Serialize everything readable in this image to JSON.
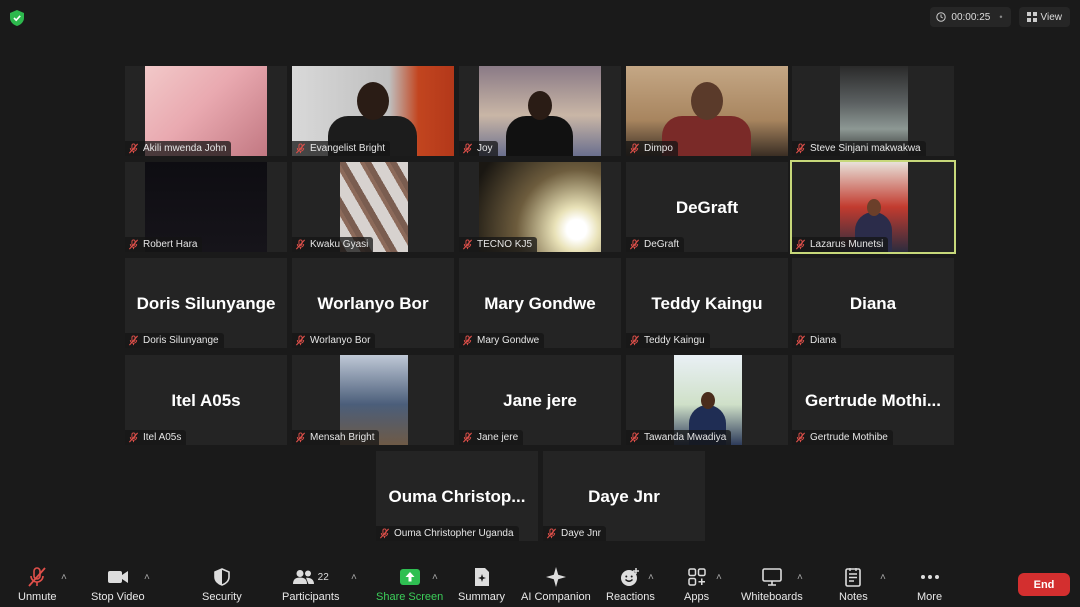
{
  "header": {
    "timer": "00:00:25",
    "view_label": "View"
  },
  "participants": [
    {
      "name": "Akili mwenda John",
      "display": "",
      "video": "akili-video"
    },
    {
      "name": "Evangelist Bright",
      "display": "",
      "video": "bright-video"
    },
    {
      "name": "Joy",
      "display": "",
      "video": "joy-video"
    },
    {
      "name": "Dimpo",
      "display": "",
      "video": "dimpo-video"
    },
    {
      "name": "Steve Sinjani makwakwa",
      "display": "",
      "video": "steve-video"
    },
    {
      "name": "Robert Hara",
      "display": "",
      "video": "robert-video"
    },
    {
      "name": "Kwaku Gyasi",
      "display": "",
      "video": "kwaku-video"
    },
    {
      "name": "TECNO KJ5",
      "display": "",
      "video": "tecno-video"
    },
    {
      "name": "DeGraft",
      "display": "DeGraft",
      "video": ""
    },
    {
      "name": "Lazarus Munetsi",
      "display": "",
      "video": "lazarus-video"
    },
    {
      "name": "Doris Silunyange",
      "display": "Doris Silunyange",
      "video": ""
    },
    {
      "name": "Worlanyo Bor",
      "display": "Worlanyo Bor",
      "video": ""
    },
    {
      "name": "Mary Gondwe",
      "display": "Mary Gondwe",
      "video": ""
    },
    {
      "name": "Teddy Kaingu",
      "display": "Teddy Kaingu",
      "video": ""
    },
    {
      "name": "Diana",
      "display": "Diana",
      "video": ""
    },
    {
      "name": "Itel A05s",
      "display": "Itel A05s",
      "video": ""
    },
    {
      "name": "Mensah Bright",
      "display": "",
      "video": "mensah-video"
    },
    {
      "name": "Jane jere",
      "display": "Jane jere",
      "video": ""
    },
    {
      "name": "Tawanda Mwadiya",
      "display": "",
      "video": "tawanda-video"
    },
    {
      "name": "Gertrude Mothibe",
      "display": "Gertrude  Mothi...",
      "video": ""
    },
    {
      "name": "Ouma Christopher  Uganda",
      "display": "Ouma  Christop...",
      "video": ""
    },
    {
      "name": "Daye Jnr",
      "display": "Daye Jnr",
      "video": ""
    }
  ],
  "toolbar": {
    "unmute": "Unmute",
    "stop_video": "Stop Video",
    "security": "Security",
    "participants": "Participants",
    "participants_count": "22",
    "share_screen": "Share Screen",
    "summary": "Summary",
    "ai_companion": "AI Companion",
    "reactions": "Reactions",
    "apps": "Apps",
    "whiteboards": "Whiteboards",
    "notes": "Notes",
    "more": "More",
    "end": "End"
  },
  "colors": {
    "share_green": "#3ccf5a",
    "end_red": "#d32f2f",
    "active_speaker": "#c7d87a",
    "muted_mic": "#e0504a"
  }
}
